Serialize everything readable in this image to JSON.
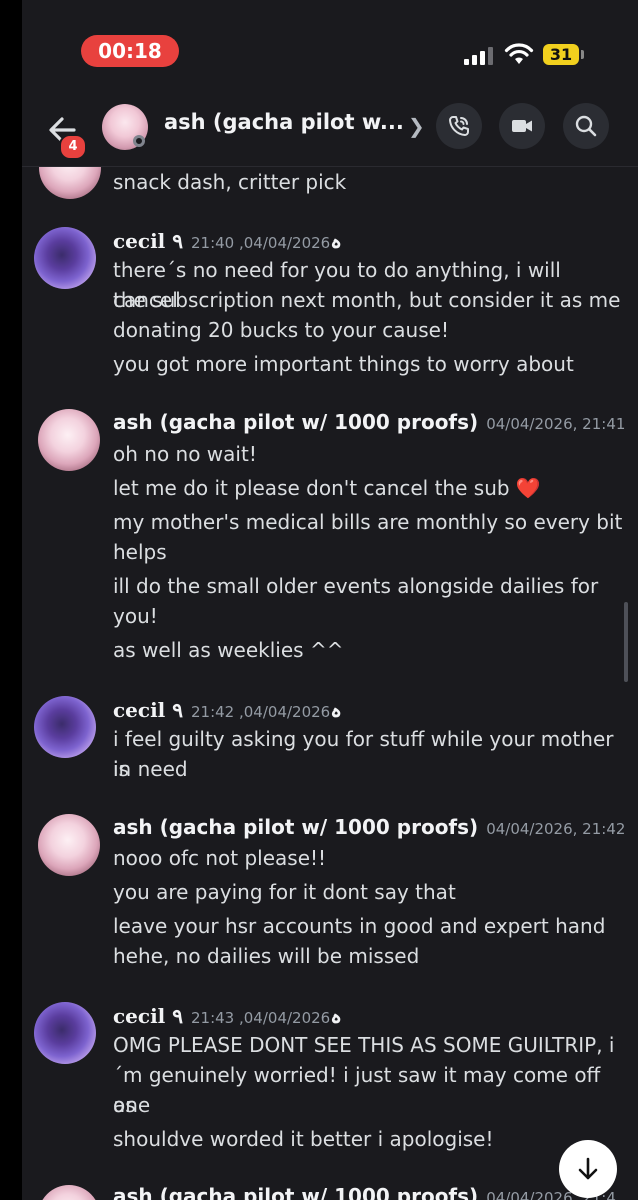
{
  "status_bar": {
    "time": "00:18",
    "battery": "31"
  },
  "header": {
    "back_badge": "4",
    "title": "ash (gacha pilot w..."
  },
  "messages": [
    {
      "author": "",
      "timestamp": "",
      "lines": [
        "snack dash, critter pick"
      ]
    },
    {
      "author": "cecil ۹ہ",
      "timestamp": "04/04/2026, 21:40",
      "lines": [
        "there´s no need for you to do anything, i will cancel",
        "the subscription next month, but consider it as me",
        "donating 20 bucks to your cause!",
        "you got more important things to worry about"
      ]
    },
    {
      "author": "ash (gacha pilot w/ 1000 proofs)",
      "timestamp": "04/04/2026, 21:41",
      "lines": [
        "oh no no wait!",
        "let me do it please don't cancel the sub",
        "my mother's medical bills are monthly so every bit",
        "helps",
        "ill do the small older events alongside dailies for",
        "you!",
        "as well as weeklies ^^"
      ]
    },
    {
      "author": "cecil ۹ہ",
      "timestamp": "04/04/2026, 21:42",
      "lines": [
        "i feel guilty asking you for stuff while your mother is",
        "in need"
      ]
    },
    {
      "author": "ash (gacha pilot w/ 1000 proofs)",
      "timestamp": "04/04/2026, 21:42",
      "lines": [
        "nooo ofc not please!!",
        "you are paying for it dont say that",
        "leave your hsr accounts in good and expert hand",
        "hehe, no dailies will be missed"
      ]
    },
    {
      "author": "cecil ۹ہ",
      "timestamp": "04/04/2026, 21:43",
      "lines": [
        "OMG PLEASE DONT SEE THIS AS SOME GUILTRIP, i",
        "´m genuinely worried! i just saw it may come off as",
        "one",
        "shouldve worded it better i apologise!"
      ]
    },
    {
      "author": "ash (gacha pilot w/ 1000 proofs)",
      "timestamp": "04/04/2026, 21:4",
      "lines": []
    }
  ],
  "emoji": {
    "heart": "❤️"
  },
  "colors": {
    "background": "#1a1a1e",
    "accent_red": "#e8413e",
    "battery": "#f1d01e"
  },
  "icons": [
    "back-arrow-icon",
    "phone-call-icon",
    "video-camera-icon",
    "search-icon",
    "chevron-right-icon",
    "arrow-down-icon",
    "heart-emoji-icon"
  ]
}
